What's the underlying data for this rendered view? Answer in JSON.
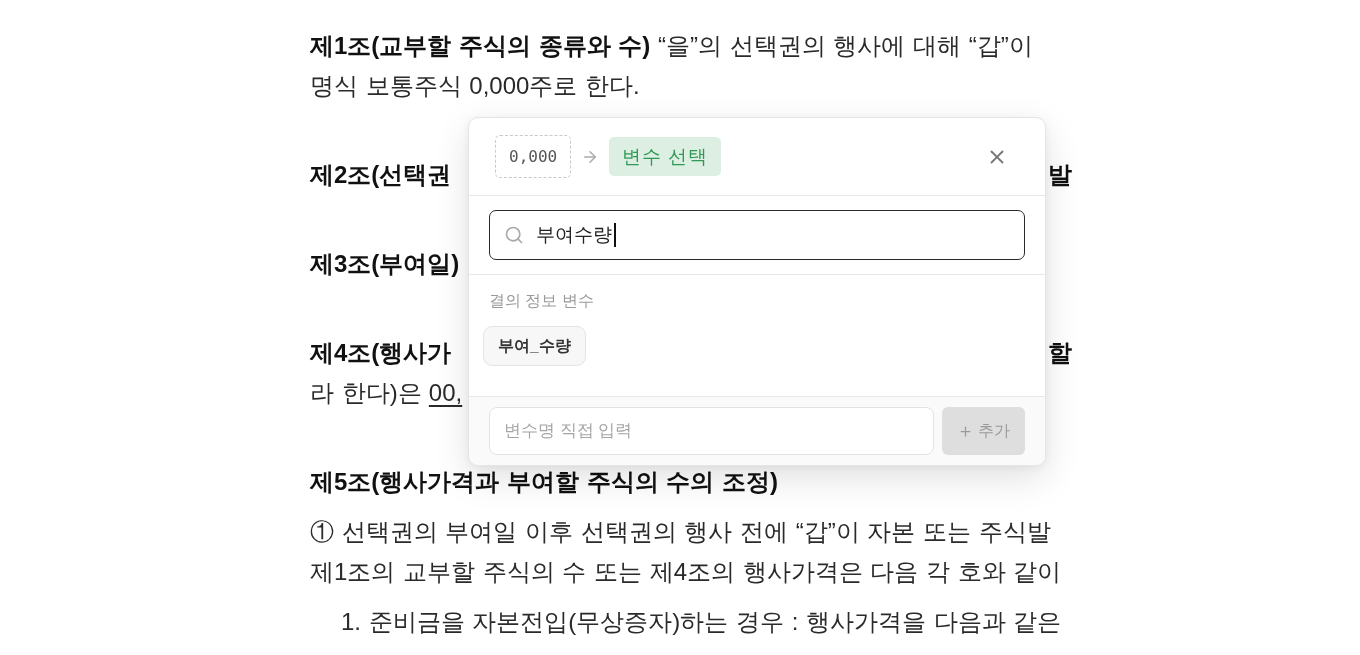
{
  "document": {
    "articles": [
      {
        "paragraphs": [
          {
            "kind": "text",
            "lines": [
              {
                "text": "**제1조(교부할 주식의 종류와 수)** “을”의 선택권의 행사에 대해 “갑”이",
                "bold": false
              },
              {
                "text": "명식 보통주식 0,000주로 한다.",
                "bold": false
              }
            ]
          }
        ]
      },
      {
        "paragraphs": [
          {
            "kind": "text",
            "lines": [
              {
                "text": "제2조(선택권",
                "bold": true,
                "right_text": "발"
              }
            ]
          }
        ]
      },
      {
        "paragraphs": [
          {
            "kind": "text",
            "lines": [
              {
                "text": "제3조(부여일)",
                "bold": true
              }
            ]
          }
        ]
      },
      {
        "paragraphs": [
          {
            "kind": "text",
            "lines": [
              {
                "text": "제4조(행사가",
                "bold": true,
                "right_text": "할"
              },
              {
                "text": "라 한다)은",
                "bold": false,
                "variable": "00,"
              }
            ]
          }
        ]
      },
      {
        "paragraphs": [
          {
            "kind": "text",
            "lines": [
              {
                "text": "제5조(행사가격과 부여할 주식의 수의 조정)",
                "bold": true
              }
            ]
          },
          {
            "kind": "text",
            "lines": [
              {
                "text": "① 선택권의 부여일 이후 선택권의 행사 전에 “갑”이 자본 또는 주식발",
                "bold": false
              },
              {
                "text": "제1조의 교부할 주식의 수 또는 제4조의 행사가격은 다음 각 호와 같이",
                "bold": false
              }
            ]
          },
          {
            "kind": "item",
            "lines": [
              {
                "text": "1. 준비금을 자본전입(무상증자)하는 경우 : 행사가격을 다음과 같은",
                "bold": false
              }
            ]
          }
        ]
      }
    ]
  },
  "popover": {
    "source_value": "0,000",
    "target_label": "변수 선택",
    "search": {
      "value": "부여수량",
      "focused": true
    },
    "section_label": "결의 정보 변수",
    "variables": [
      {
        "label": "부여_수량"
      }
    ],
    "custom_input": {
      "placeholder": "변수명 직접 입력"
    },
    "add_button": {
      "label": "추가",
      "disabled": true
    }
  }
}
